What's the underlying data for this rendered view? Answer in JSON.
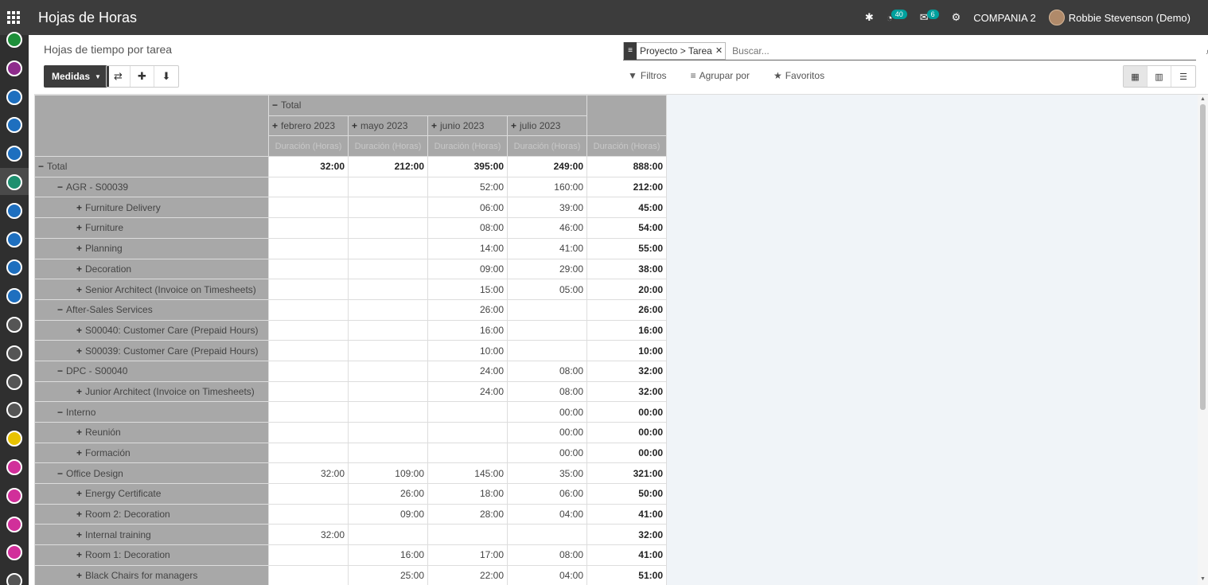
{
  "navbar": {
    "title": "Hojas de Horas",
    "activity_badge": "40",
    "messages_badge": "6",
    "company": "COMPANIA 2",
    "user": "Robbie Stevenson (Demo)"
  },
  "sidebar": {
    "colors": [
      "#1e8f3a",
      "#8e2b8c",
      "#1e6fbf",
      "#1e6fbf",
      "#1e6fbf",
      "#1e8f6f",
      "#1e6fbf",
      "#1e6fbf",
      "#1e6fbf",
      "#1e6fbf",
      "#555",
      "#555",
      "#555",
      "#555",
      "#e8c200",
      "#d12f9a",
      "#d12f9a",
      "#d12f9a",
      "#d12f9a",
      "#555"
    ]
  },
  "control": {
    "breadcrumb": "Hojas de tiempo por tarea",
    "measures_label": "Medidas",
    "facet": "Proyecto > Tarea",
    "search_placeholder": "Buscar...",
    "filters_label": "Filtros",
    "groupby_label": "Agrupar por",
    "favorites_label": "Favoritos"
  },
  "pivot": {
    "total_header": "Total",
    "columns": [
      "febrero 2023",
      "mayo 2023",
      "junio 2023",
      "julio 2023"
    ],
    "measure": "Duración (Horas)",
    "rows": [
      {
        "label": "Total",
        "level": 0,
        "sign": "−",
        "values": [
          "32:00",
          "212:00",
          "395:00",
          "249:00"
        ],
        "total": "888:00",
        "bold": true
      },
      {
        "label": "AGR - S00039",
        "level": 1,
        "sign": "−",
        "values": [
          "",
          "",
          "52:00",
          "160:00"
        ],
        "total": "212:00"
      },
      {
        "label": "Furniture Delivery",
        "level": 2,
        "sign": "+",
        "values": [
          "",
          "",
          "06:00",
          "39:00"
        ],
        "total": "45:00"
      },
      {
        "label": "Furniture",
        "level": 2,
        "sign": "+",
        "values": [
          "",
          "",
          "08:00",
          "46:00"
        ],
        "total": "54:00"
      },
      {
        "label": "Planning",
        "level": 2,
        "sign": "+",
        "values": [
          "",
          "",
          "14:00",
          "41:00"
        ],
        "total": "55:00"
      },
      {
        "label": "Decoration",
        "level": 2,
        "sign": "+",
        "values": [
          "",
          "",
          "09:00",
          "29:00"
        ],
        "total": "38:00"
      },
      {
        "label": "Senior Architect (Invoice on Timesheets)",
        "level": 2,
        "sign": "+",
        "values": [
          "",
          "",
          "15:00",
          "05:00"
        ],
        "total": "20:00"
      },
      {
        "label": "After-Sales Services",
        "level": 1,
        "sign": "−",
        "values": [
          "",
          "",
          "26:00",
          ""
        ],
        "total": "26:00"
      },
      {
        "label": "S00040: Customer Care (Prepaid Hours)",
        "level": 2,
        "sign": "+",
        "values": [
          "",
          "",
          "16:00",
          ""
        ],
        "total": "16:00"
      },
      {
        "label": "S00039: Customer Care (Prepaid Hours)",
        "level": 2,
        "sign": "+",
        "values": [
          "",
          "",
          "10:00",
          ""
        ],
        "total": "10:00"
      },
      {
        "label": "DPC - S00040",
        "level": 1,
        "sign": "−",
        "values": [
          "",
          "",
          "24:00",
          "08:00"
        ],
        "total": "32:00"
      },
      {
        "label": "Junior Architect (Invoice on Timesheets)",
        "level": 2,
        "sign": "+",
        "values": [
          "",
          "",
          "24:00",
          "08:00"
        ],
        "total": "32:00"
      },
      {
        "label": "Interno",
        "level": 1,
        "sign": "−",
        "values": [
          "",
          "",
          "",
          "00:00"
        ],
        "total": "00:00"
      },
      {
        "label": "Reunión",
        "level": 2,
        "sign": "+",
        "values": [
          "",
          "",
          "",
          "00:00"
        ],
        "total": "00:00"
      },
      {
        "label": "Formación",
        "level": 2,
        "sign": "+",
        "values": [
          "",
          "",
          "",
          "00:00"
        ],
        "total": "00:00"
      },
      {
        "label": "Office Design",
        "level": 1,
        "sign": "−",
        "values": [
          "32:00",
          "109:00",
          "145:00",
          "35:00"
        ],
        "total": "321:00"
      },
      {
        "label": "Energy Certificate",
        "level": 2,
        "sign": "+",
        "values": [
          "",
          "26:00",
          "18:00",
          "06:00"
        ],
        "total": "50:00"
      },
      {
        "label": "Room 2: Decoration",
        "level": 2,
        "sign": "+",
        "values": [
          "",
          "09:00",
          "28:00",
          "04:00"
        ],
        "total": "41:00"
      },
      {
        "label": "Internal training",
        "level": 2,
        "sign": "+",
        "values": [
          "32:00",
          "",
          "",
          ""
        ],
        "total": "32:00"
      },
      {
        "label": "Room 1: Decoration",
        "level": 2,
        "sign": "+",
        "values": [
          "",
          "16:00",
          "17:00",
          "08:00"
        ],
        "total": "41:00"
      },
      {
        "label": "Black Chairs for managers",
        "level": 2,
        "sign": "+",
        "values": [
          "",
          "25:00",
          "22:00",
          "04:00"
        ],
        "total": "51:00"
      }
    ]
  }
}
